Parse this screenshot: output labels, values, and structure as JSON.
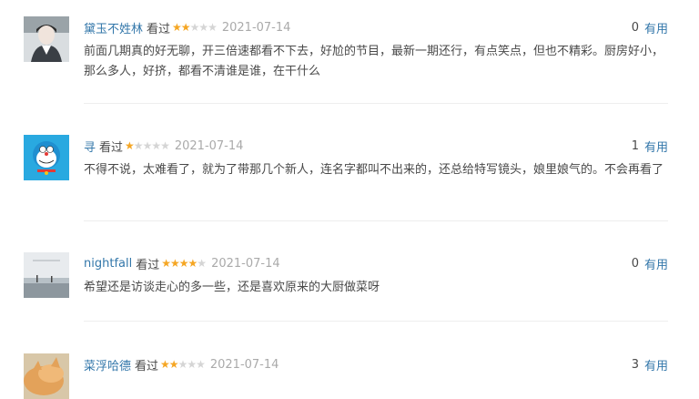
{
  "comments": [
    {
      "user": "黛玉不姓林",
      "status": "看过",
      "stars": 2,
      "date": "2021-07-14",
      "votes": "0",
      "useful_label": "有用",
      "text": "前面几期真的好无聊，开三倍速都看不下去，好尬的节目，最新一期还行，有点笑点，但也不精彩。厨房好小，那么多人，好挤，都看不清谁是谁，在干什么"
    },
    {
      "user": "寻",
      "status": "看过",
      "stars": 1,
      "date": "2021-07-14",
      "votes": "1",
      "useful_label": "有用",
      "text": "不得不说，太难看了，就为了带那几个新人，连名字都叫不出来的，还总给特写镜头，娘里娘气的。不会再看了"
    },
    {
      "user": "nightfall",
      "status": "看过",
      "stars": 4,
      "date": "2021-07-14",
      "votes": "0",
      "useful_label": "有用",
      "text": "希望还是访谈走心的多一些，还是喜欢原来的大厨做菜呀"
    },
    {
      "user": "菜浮哈德",
      "status": "看过",
      "stars": 2,
      "date": "2021-07-14",
      "votes": "3",
      "useful_label": "有用",
      "text": ""
    }
  ],
  "colors": {
    "link": "#3377aa",
    "star": "#f5a623",
    "star_empty": "#d5d5d5",
    "date": "#aaaaaa"
  }
}
